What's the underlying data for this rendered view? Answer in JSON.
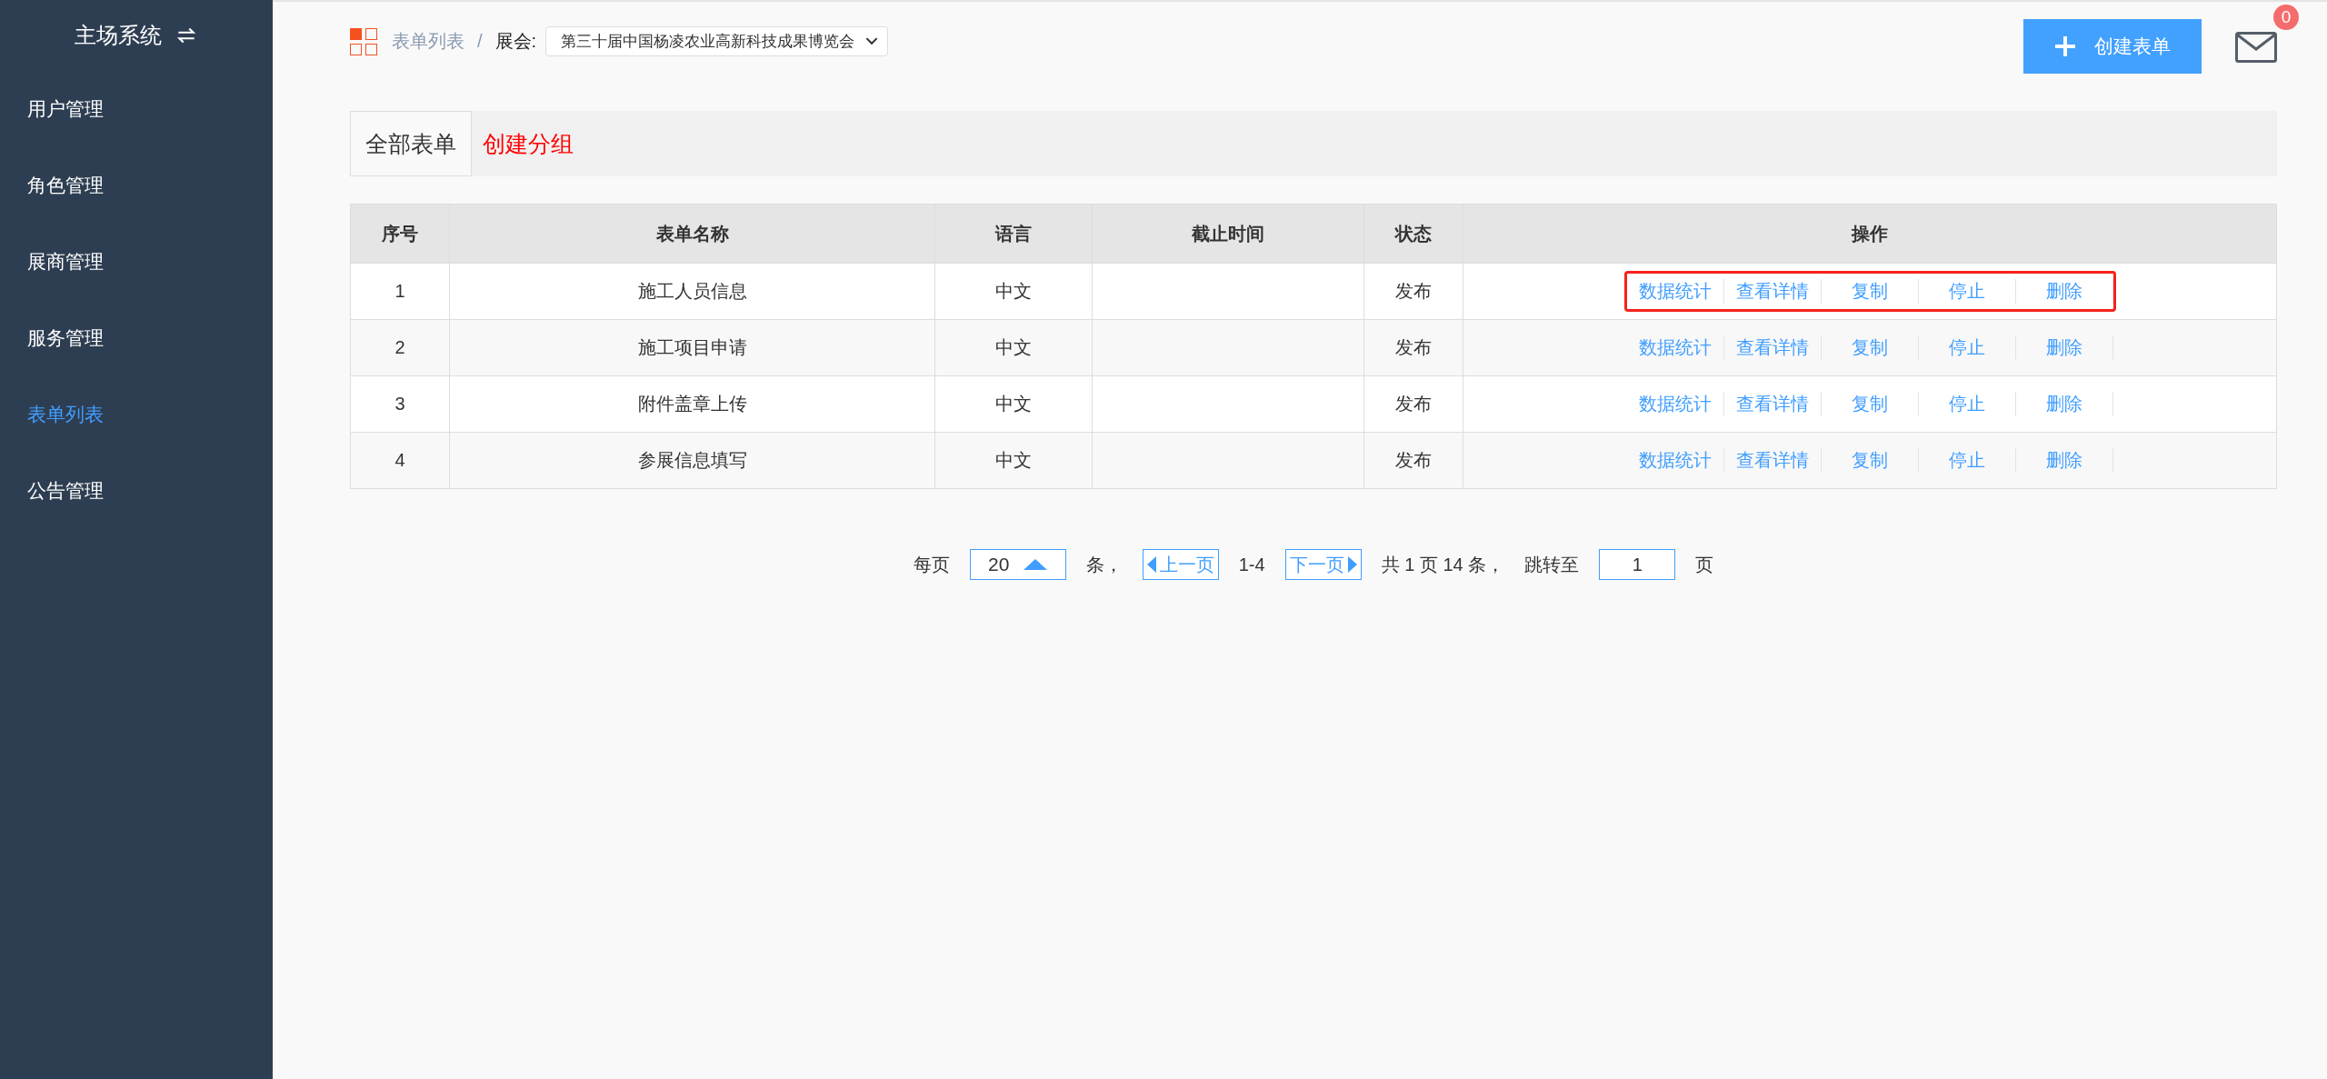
{
  "sidebar": {
    "title": "主场系统",
    "items": [
      {
        "label": "用户管理",
        "selected": false
      },
      {
        "label": "角色管理",
        "selected": false
      },
      {
        "label": "展商管理",
        "selected": false
      },
      {
        "label": "服务管理",
        "selected": false
      },
      {
        "label": "表单列表",
        "selected": true
      },
      {
        "label": "公告管理",
        "selected": false
      }
    ]
  },
  "breadcrumb": {
    "current": "表单列表",
    "separator": "/",
    "expo_label": "展会:",
    "expo_select": "第三十届中国杨凌农业高新科技成果博览会"
  },
  "create_button": "创建表单",
  "mail_badge": "0",
  "group_tabs": [
    {
      "label": "全部表单",
      "kind": "tab",
      "selected": true
    },
    {
      "label": "创建分组",
      "kind": "link",
      "selected": false
    }
  ],
  "table": {
    "columns": [
      "序号",
      "表单名称",
      "语言",
      "截止时间",
      "状态",
      "操作"
    ],
    "rows": [
      {
        "cells": [
          "1",
          "施工人员信息",
          "中文",
          "",
          "发布"
        ],
        "actions": [
          "数据统计",
          "查看详情",
          "复制",
          "停止",
          "删除"
        ],
        "highlighted": true
      },
      {
        "cells": [
          "2",
          "施工项目申请",
          "中文",
          "",
          "发布"
        ],
        "actions": [
          "数据统计",
          "查看详情",
          "复制",
          "停止",
          "删除"
        ],
        "highlighted": false
      },
      {
        "cells": [
          "3",
          "附件盖章上传",
          "中文",
          "",
          "发布"
        ],
        "actions": [
          "数据统计",
          "查看详情",
          "复制",
          "停止",
          "删除"
        ],
        "highlighted": false
      },
      {
        "cells": [
          "4",
          "参展信息填写",
          "中文",
          "",
          "发布"
        ],
        "actions": [
          "数据统计",
          "查看详情",
          "复制",
          "停止",
          "删除"
        ],
        "highlighted": false
      }
    ]
  },
  "pagination": {
    "per_page_label": "每页",
    "per_page": "20",
    "unit": "条，",
    "prev": "上一页",
    "range": "1-4",
    "next": "下一页",
    "summary": "共 1 页 14 条，",
    "jump_label": "跳转至",
    "page": "1",
    "page_unit": "页"
  }
}
